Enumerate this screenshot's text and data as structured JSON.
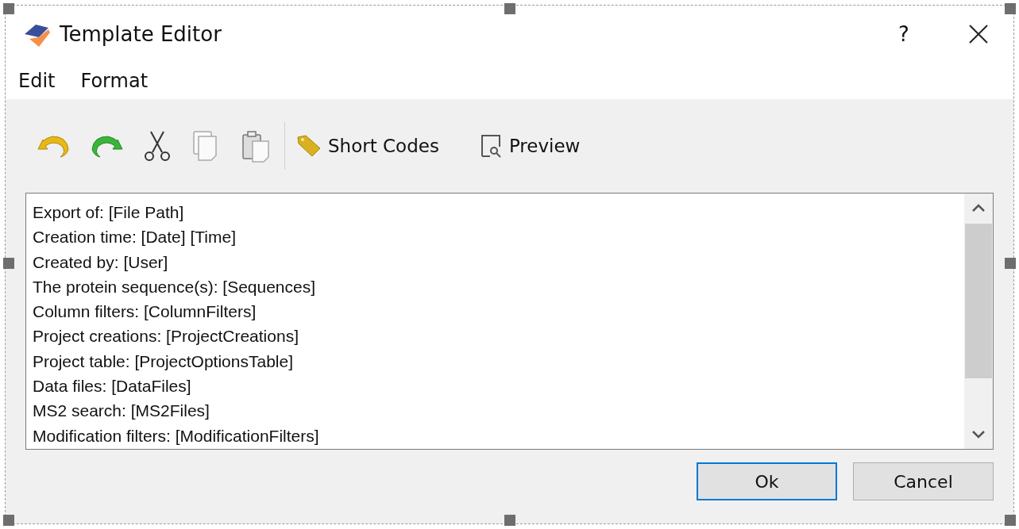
{
  "window": {
    "title": "Template Editor",
    "help": "?"
  },
  "menu": [
    "Edit",
    "Format"
  ],
  "toolbar": {
    "icons": [
      {
        "kind": "undo"
      },
      {
        "kind": "redo"
      },
      {
        "kind": "cut"
      },
      {
        "kind": "copy"
      },
      {
        "kind": "paste"
      }
    ],
    "buttons": [
      {
        "kind": "tag",
        "label": "Short Codes"
      },
      {
        "kind": "preview",
        "label": "Preview"
      }
    ]
  },
  "editor": {
    "lines": [
      "Export of: [File Path]",
      "Creation time: [Date] [Time]",
      "Created by: [User]",
      "The protein sequence(s): [Sequences]",
      "Column filters: [ColumnFilters]",
      "Project creations: [ProjectCreations]",
      "Project table: [ProjectOptionsTable]",
      "Data files: [DataFiles]",
      "MS2 search: [MS2Files]",
      "Modification filters: [ModificationFilters]"
    ]
  },
  "buttons": [
    {
      "label": "Ok",
      "selected": true
    },
    {
      "label": "Cancel",
      "selected": false
    }
  ]
}
